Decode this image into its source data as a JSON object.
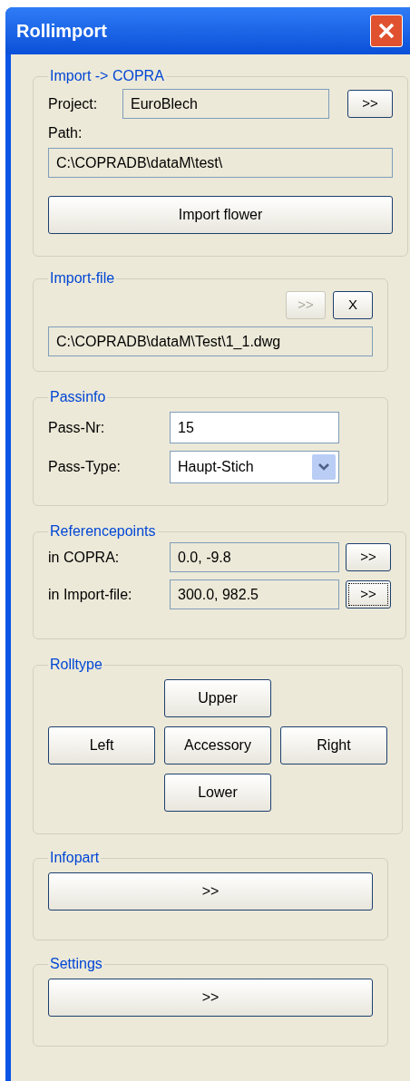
{
  "window": {
    "title": "Rollimport"
  },
  "sections": [
    {
      "kind": "import",
      "legend": "Import -> COPRA",
      "project_label": "Project:",
      "project_value": "EuroBlech",
      "browse": {
        "label": ">>",
        "disabled": false,
        "focused": false
      },
      "path_label": "Path:",
      "path_value": "C:\\COPRADB\\dataM\\test\\",
      "action": "Import flower"
    },
    {
      "kind": "file",
      "legend": "Import-file",
      "buttons": [
        {
          "label": ">>",
          "disabled": true,
          "focused": false
        },
        {
          "label": "X",
          "disabled": false,
          "focused": false
        }
      ],
      "value": "C:\\COPRADB\\dataM\\Test\\1_1.dwg"
    },
    {
      "kind": "passinfo",
      "legend": "Passinfo",
      "nr_label": "Pass-Nr:",
      "nr_value": "15",
      "type_label": "Pass-Type:",
      "type_value": "Haupt-Stich"
    },
    {
      "kind": "refpoints",
      "legend": "Referencepoints",
      "rows": [
        {
          "label": "in COPRA:",
          "value": "0.0, -9.8",
          "button": {
            "label": ">>",
            "disabled": false,
            "focused": false
          }
        },
        {
          "label": "in Import-file:",
          "value": "300.0, 982.5",
          "button": {
            "label": ">>",
            "disabled": false,
            "focused": true
          }
        }
      ]
    },
    {
      "kind": "rolltype",
      "legend": "Rolltype",
      "upper": "Upper",
      "left": "Left",
      "center": "Accessory",
      "right": "Right",
      "lower": "Lower"
    },
    {
      "kind": "expander",
      "legend": "Infopart",
      "button": ">>"
    },
    {
      "kind": "expander",
      "legend": "Settings",
      "button": ">>"
    }
  ]
}
